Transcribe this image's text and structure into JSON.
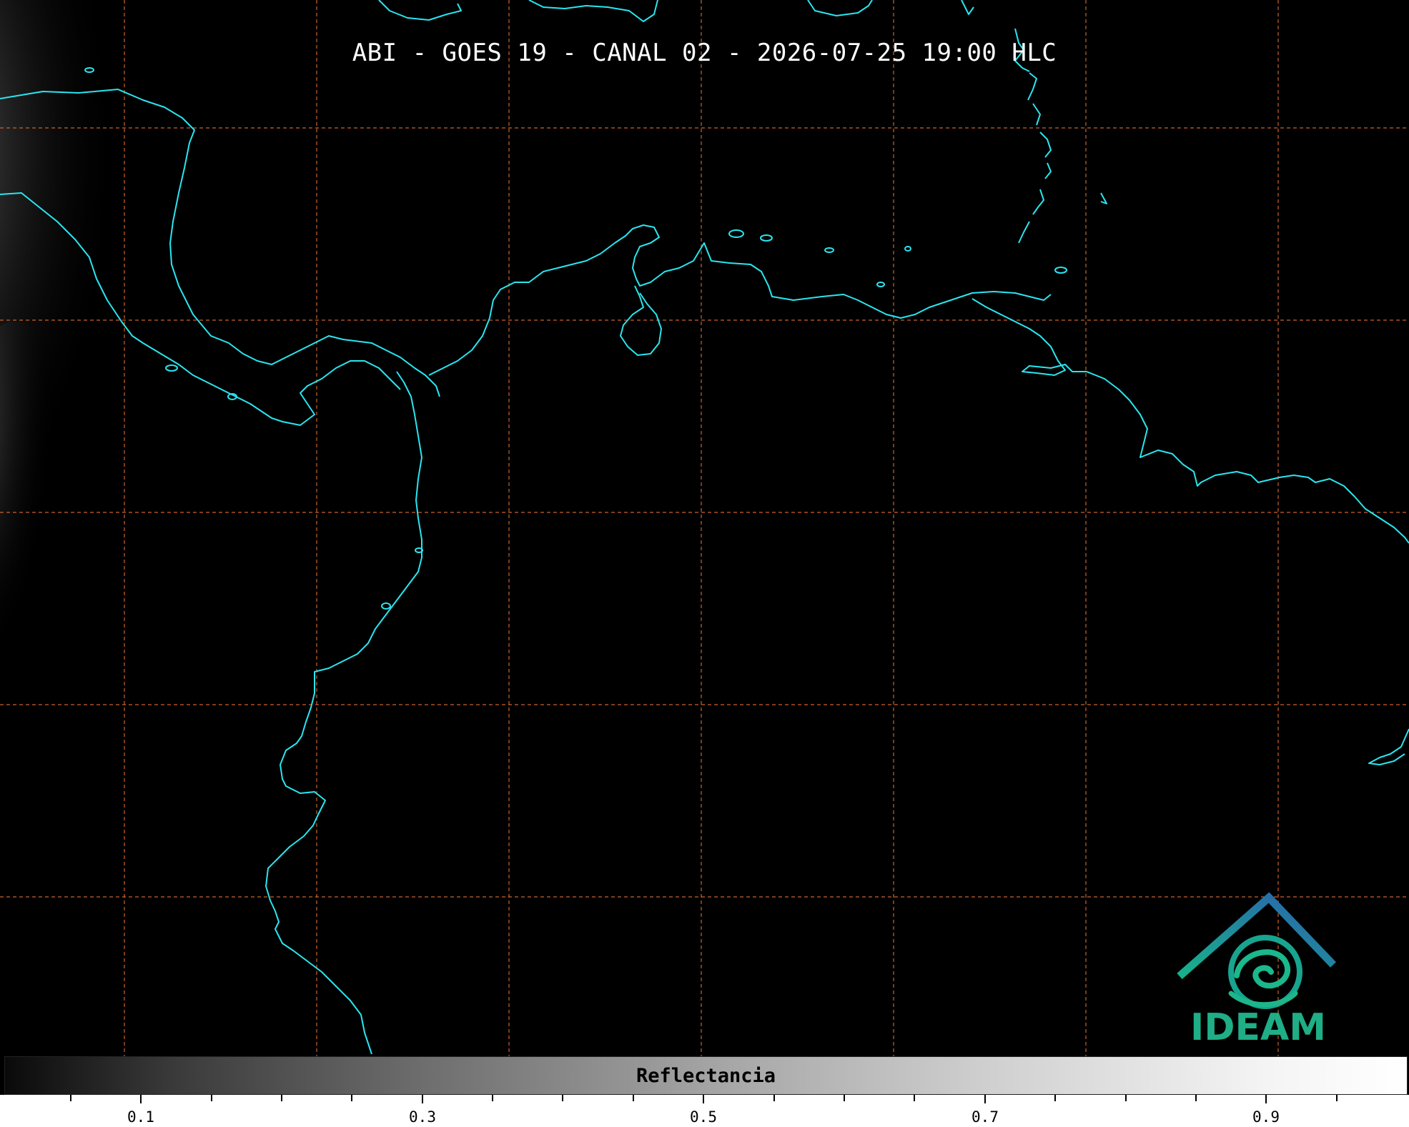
{
  "title": "ABI - GOES 19 - CANAL 02 - 2026-07-25 19:00 HLC",
  "colorbar": {
    "label": "Reflectancia",
    "ticks": [
      "0.1",
      "0.3",
      "0.5",
      "0.7",
      "0.9"
    ]
  },
  "logo": {
    "text": "IDEAM"
  },
  "colors": {
    "coastline": "#29e6f0",
    "grid": "#c8632a",
    "background": "#000000"
  }
}
